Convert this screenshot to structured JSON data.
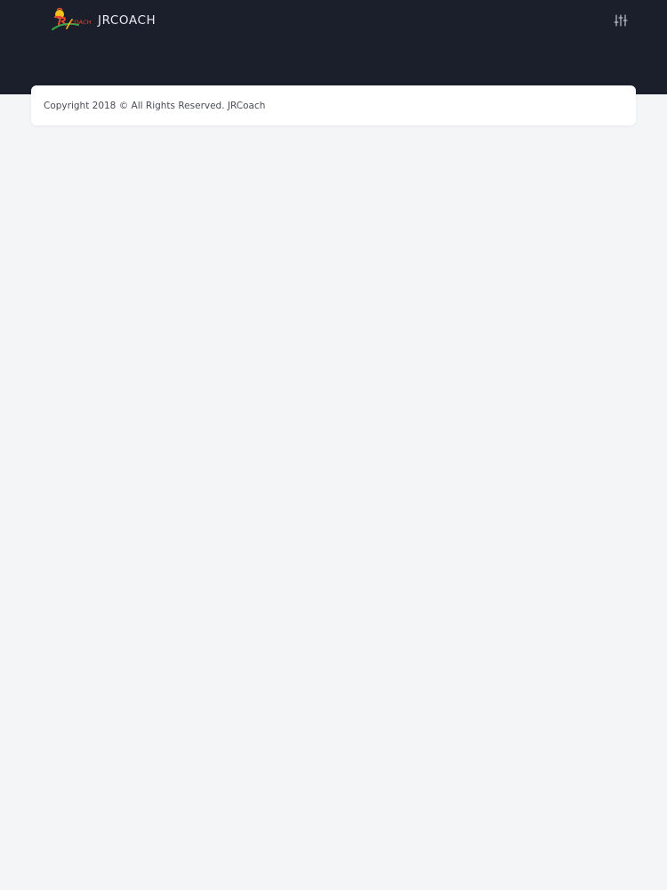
{
  "header": {
    "brand_name": "JRCOACH",
    "logo_icon": "jrcoach-logo-icon",
    "settings_icon": "sliders-icon",
    "background_color": "#1b1e2b"
  },
  "footer": {
    "copyright_text": "Copyright 2018 © All Rights Reserved. JRCoach"
  },
  "colors": {
    "page_background": "#f4f5f7",
    "card_background": "#ffffff",
    "text_muted": "#4a4d57"
  }
}
